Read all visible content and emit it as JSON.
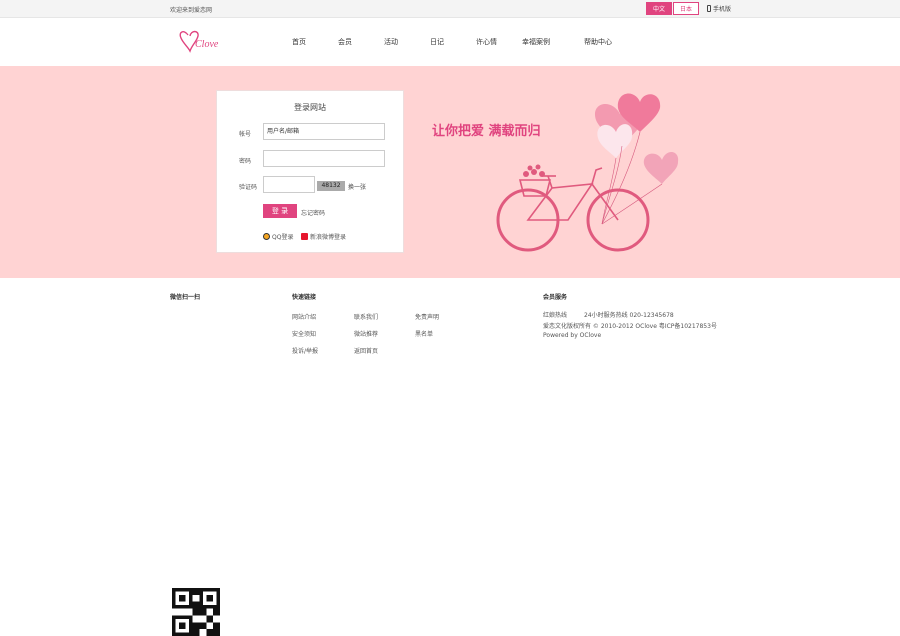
{
  "topbar": {
    "welcome": "欢迎来到爱恋网",
    "lang_active": "中文",
    "lang_other": "日本",
    "mobile": "手机版"
  },
  "nav": {
    "items": [
      "首页",
      "会员",
      "活动",
      "日记",
      "许心情",
      "幸福案例",
      "帮助中心"
    ]
  },
  "login": {
    "title": "登录网站",
    "account_label": "帐号",
    "account_value": "用户名/邮箱",
    "password_label": "密码",
    "password_value": "",
    "captcha_label": "验证码",
    "captcha_code": "48132",
    "captcha_refresh": "换一张",
    "submit": "登 录",
    "forgot": "忘记密码",
    "qq_login": "QQ登录",
    "weibo_login": "新浪微博登录"
  },
  "hero": {
    "slogan": "让你把爱 满载而归",
    "colors": {
      "accent": "#e0447f",
      "bg": "#ffd3d3"
    }
  },
  "footer": {
    "follow_title": "微信扫一扫",
    "links_title": "快速链接",
    "links_col1": [
      "网站介绍",
      "安全须知",
      "投诉/举报"
    ],
    "links_col2": [
      "联系我们",
      "微站推荐",
      "返回首页"
    ],
    "links_col3": [
      "免责声明",
      "黑名单"
    ],
    "service_title": "会员服务",
    "service_line1_a": "红娘热线",
    "service_line1_b": "24小时服务热线 020-12345678",
    "service_line2": "爱恋文化版权所有 © 2010-2012 OClove   粤ICP备10217853号",
    "service_line3": "Powered by OClove"
  }
}
